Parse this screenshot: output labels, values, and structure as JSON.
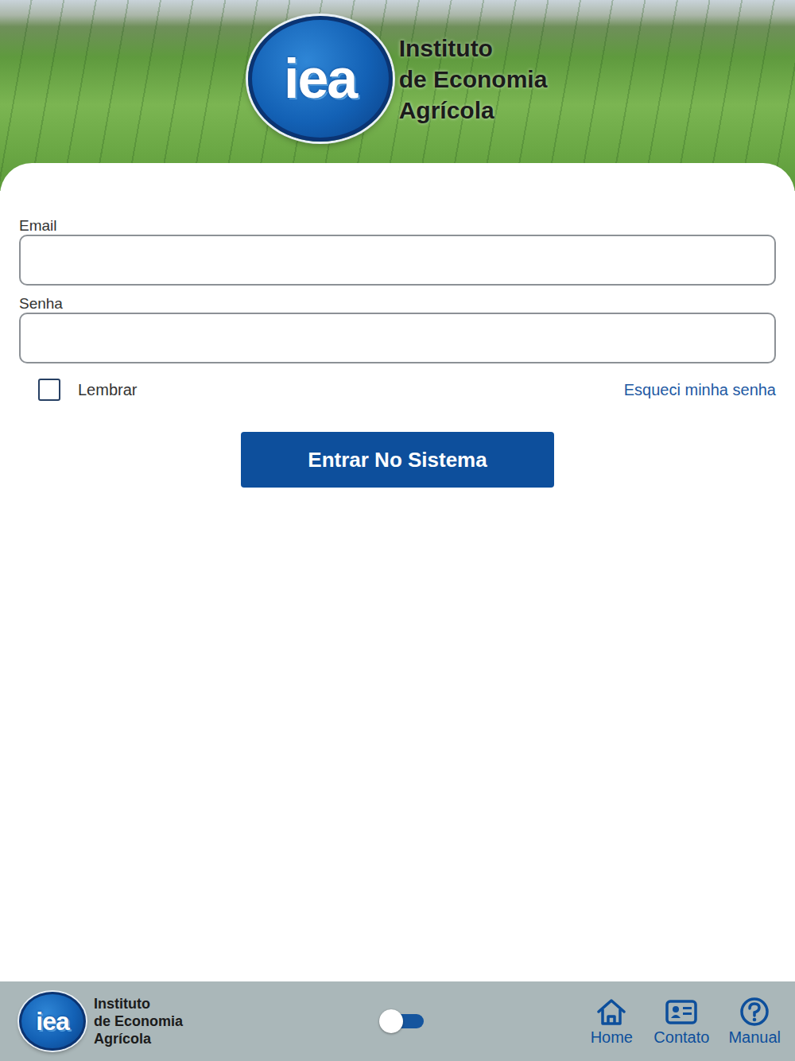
{
  "header": {
    "logo": {
      "mark": "iea",
      "lines": [
        "Instituto",
        "de Economia",
        "Agrícola"
      ]
    }
  },
  "form": {
    "fields": [
      {
        "label": "Email",
        "kind": "email"
      },
      {
        "label": "Senha",
        "kind": "password"
      }
    ],
    "remember": {
      "label": "Lembrar",
      "checked": false
    },
    "forgot": "Esqueci minha senha",
    "submit": "Entrar No Sistema"
  },
  "footer": {
    "logo": {
      "mark": "iea",
      "lines": [
        "Instituto",
        "de Economia",
        "Agrícola"
      ]
    },
    "theme_toggle": {
      "on": false
    },
    "nav": [
      {
        "label": "Home",
        "selected": false
      },
      {
        "label": "Contato",
        "selected": false
      },
      {
        "label": "Manual",
        "selected": false
      }
    ]
  }
}
